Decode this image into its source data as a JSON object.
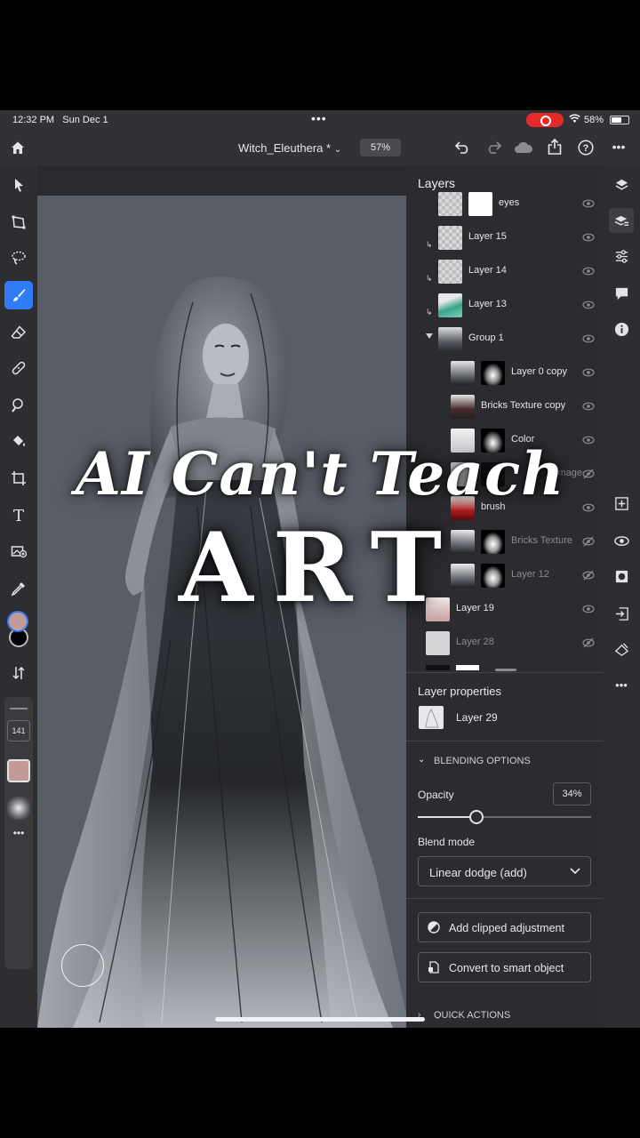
{
  "status_bar": {
    "time": "12:32 PM",
    "date": "Sun Dec 1",
    "battery": "58%"
  },
  "toolbar": {
    "document_title": "Witch_Eleuthera *",
    "zoom": "57%"
  },
  "tools": {
    "brush_size": "141",
    "primary_color": "#c29a98",
    "secondary_color": "#000000",
    "swatch_color": "#c29a98"
  },
  "overlay": {
    "line1": "AI Can't Teach",
    "line2": "ART"
  },
  "layers_panel": {
    "title": "Layers",
    "layers": [
      {
        "name": "eyes"
      },
      {
        "name": "Layer 15"
      },
      {
        "name": "Layer 14"
      },
      {
        "name": "Layer 13"
      },
      {
        "name": "Group 1"
      },
      {
        "name": "Layer 0 copy"
      },
      {
        "name": "Bricks Texture copy"
      },
      {
        "name": "Color"
      },
      {
        "name": "image"
      },
      {
        "name": "brush"
      },
      {
        "name": "Bricks Texture"
      },
      {
        "name": "Layer 12"
      },
      {
        "name": "Layer 19"
      },
      {
        "name": "Layer 28"
      }
    ]
  },
  "layer_properties": {
    "title": "Layer properties",
    "layer_name": "Layer 29",
    "blending_header": "BLENDING OPTIONS",
    "opacity_label": "Opacity",
    "opacity_value": "34%",
    "opacity_fraction": 0.34,
    "blend_mode_label": "Blend mode",
    "blend_mode_value": "Linear dodge (add)",
    "add_clipped_label": "Add clipped adjustment",
    "convert_smart_label": "Convert to smart object",
    "quick_actions_header": "QUICK ACTIONS"
  },
  "colors": {
    "accent": "#2f7cf6",
    "panel_bg": "#2c2c30",
    "canvas_bg": "#595d66"
  }
}
